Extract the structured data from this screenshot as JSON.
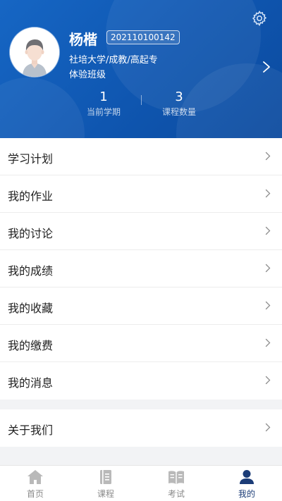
{
  "profile": {
    "name": "杨楷",
    "student_id": "202110100142",
    "school": "社培大学/成教/高起专",
    "class_name": "体验班级"
  },
  "stats": [
    {
      "value": "1",
      "label": "当前学期"
    },
    {
      "value": "3",
      "label": "课程数量"
    }
  ],
  "menu_group_1": [
    {
      "label": "学习计划"
    },
    {
      "label": "我的作业"
    },
    {
      "label": "我的讨论"
    },
    {
      "label": "我的成绩"
    },
    {
      "label": "我的收藏"
    },
    {
      "label": "我的缴费"
    },
    {
      "label": "我的消息"
    }
  ],
  "menu_group_2": [
    {
      "label": "关于我们"
    }
  ],
  "tabbar": [
    {
      "label": "首页",
      "icon": "home-icon",
      "active": false
    },
    {
      "label": "课程",
      "icon": "book-icon",
      "active": false
    },
    {
      "label": "考试",
      "icon": "open-book-icon",
      "active": false
    },
    {
      "label": "我的",
      "icon": "person-icon",
      "active": true
    }
  ],
  "colors": {
    "header_blue": "#1261bd",
    "active_tab": "#1b3c77",
    "inactive_tab": "#8a8a8a"
  }
}
